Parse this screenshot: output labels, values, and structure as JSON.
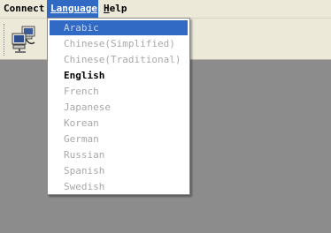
{
  "menubar": {
    "connect": "Connect",
    "language": "Language",
    "help": "Help"
  },
  "toolbar": {
    "connect_icon": "network-computers-icon"
  },
  "language_menu": {
    "items": [
      {
        "label": "Arabic",
        "state": "highlighted-disabled"
      },
      {
        "label": "Chinese(Simplified)",
        "state": "disabled"
      },
      {
        "label": "Chinese(Traditional)",
        "state": "disabled"
      },
      {
        "label": "English",
        "state": "enabled"
      },
      {
        "label": "French",
        "state": "disabled"
      },
      {
        "label": "Japanese",
        "state": "disabled"
      },
      {
        "label": "Korean",
        "state": "disabled"
      },
      {
        "label": "German",
        "state": "disabled"
      },
      {
        "label": "Russian",
        "state": "disabled"
      },
      {
        "label": "Spanish",
        "state": "disabled"
      },
      {
        "label": "Swedish",
        "state": "disabled"
      }
    ]
  },
  "colors": {
    "menu_bg": "#ece9d8",
    "highlight": "#316ac5",
    "client_bg": "#8c8c8c",
    "disabled_text": "#a8a8a8"
  }
}
